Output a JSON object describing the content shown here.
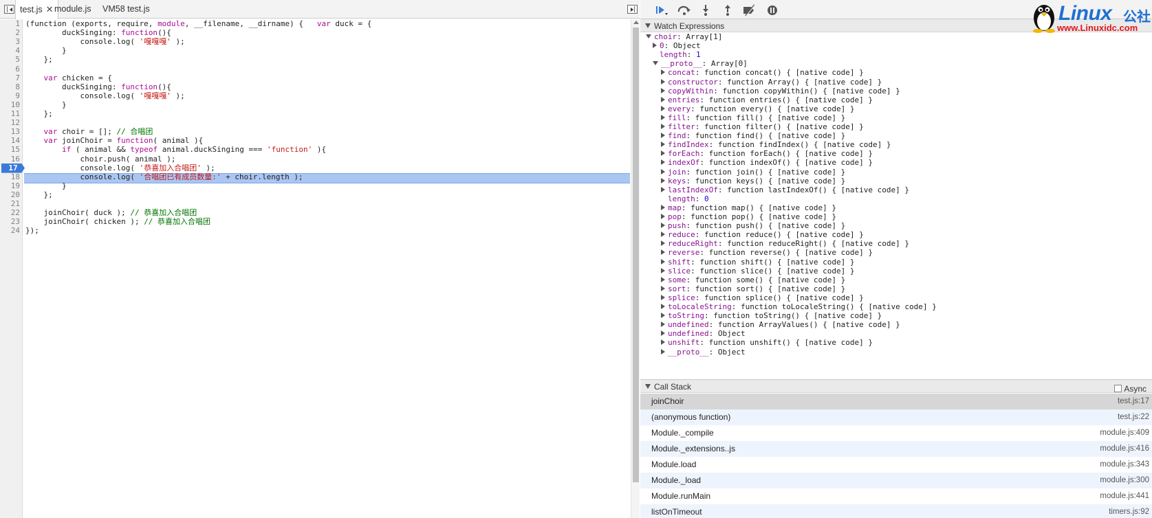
{
  "tabs": [
    {
      "label": "test.js",
      "active": true
    },
    {
      "label": "module.js",
      "active": false
    },
    {
      "label": "VM58 test.js",
      "active": false
    }
  ],
  "editor": {
    "current_line": 17,
    "lines": [
      "1",
      "2",
      "3",
      "4",
      "5",
      "6",
      "7",
      "8",
      "9",
      "10",
      "11",
      "12",
      "13",
      "14",
      "15",
      "16",
      "17",
      "18",
      "19",
      "20",
      "21",
      "22",
      "23",
      "24"
    ],
    "code": {
      "l1a": "(function (exports, require, ",
      "l1b": "module",
      "l1c": ", __filename, __dirname) {   ",
      "l1d": "var",
      "l1e": " duck = {",
      "l2a": "        duckSinging: ",
      "l2b": "function",
      "l2c": "(){",
      "l3a": "            console.log( ",
      "l3b": "'嘎嘎嘎'",
      "l3c": " );",
      "l4": "        }",
      "l5": "    };",
      "l7a": "    ",
      "l7b": "var",
      "l7c": " chicken = {",
      "l8a": "        duckSinging: ",
      "l8b": "function",
      "l8c": "(){",
      "l9a": "            console.log( ",
      "l9b": "'嘎嘎嘎'",
      "l9c": " );",
      "l10": "        }",
      "l11": "    };",
      "l13a": "    ",
      "l13b": "var",
      "l13c": " choir = []; ",
      "l13d": "// 合唱团",
      "l14a": "    ",
      "l14b": "var",
      "l14c": " joinChoir = ",
      "l14d": "function",
      "l14e": "( animal ){",
      "l15a": "        ",
      "l15b": "if",
      "l15c": " ( animal && ",
      "l15d": "typeof",
      "l15e": " animal.duckSinging === ",
      "l15f": "'function'",
      "l15g": " ){",
      "l16": "            choir.push( animal );",
      "l17a": "            console.log( ",
      "l17b": "'恭喜加入合唱团'",
      "l17c": " );",
      "l18a": "            console.log( ",
      "l18b": "'合唱团已有成员数量:'",
      "l18c": " + choir.length );",
      "l19": "        }",
      "l20": "    };",
      "l22a": "    joinChoir( duck ); ",
      "l22b": "// 恭喜加入合唱团",
      "l23a": "    joinChoir( chicken ); ",
      "l23b": "// 恭喜加入合唱团",
      "l24": "});"
    }
  },
  "watch": {
    "title": "Watch Expressions",
    "root_key": "choir",
    "root_val": ": Array[1]",
    "item0_key": "0",
    "item0_val": ": Object",
    "length_key": "length",
    "length_sep": ": ",
    "length_val": "1",
    "proto_key": "__proto__",
    "proto_val": ": Array[0]",
    "proto_items": [
      {
        "key": "concat",
        "val": ": function concat() { [native code] }"
      },
      {
        "key": "constructor",
        "val": ": function Array() { [native code] }"
      },
      {
        "key": "copyWithin",
        "val": ": function copyWithin() { [native code] }"
      },
      {
        "key": "entries",
        "val": ": function entries() { [native code] }"
      },
      {
        "key": "every",
        "val": ": function every() { [native code] }"
      },
      {
        "key": "fill",
        "val": ": function fill() { [native code] }"
      },
      {
        "key": "filter",
        "val": ": function filter() { [native code] }"
      },
      {
        "key": "find",
        "val": ": function find() { [native code] }"
      },
      {
        "key": "findIndex",
        "val": ": function findIndex() { [native code] }"
      },
      {
        "key": "forEach",
        "val": ": function forEach() { [native code] }"
      },
      {
        "key": "indexOf",
        "val": ": function indexOf() { [native code] }"
      },
      {
        "key": "join",
        "val": ": function join() { [native code] }"
      },
      {
        "key": "keys",
        "val": ": function keys() { [native code] }"
      },
      {
        "key": "lastIndexOf",
        "val": ": function lastIndexOf() { [native code] }"
      },
      {
        "key": "length",
        "val": ": ",
        "num": "0",
        "leaf": true
      },
      {
        "key": "map",
        "val": ": function map() { [native code] }"
      },
      {
        "key": "pop",
        "val": ": function pop() { [native code] }"
      },
      {
        "key": "push",
        "val": ": function push() { [native code] }"
      },
      {
        "key": "reduce",
        "val": ": function reduce() { [native code] }"
      },
      {
        "key": "reduceRight",
        "val": ": function reduceRight() { [native code] }"
      },
      {
        "key": "reverse",
        "val": ": function reverse() { [native code] }"
      },
      {
        "key": "shift",
        "val": ": function shift() { [native code] }"
      },
      {
        "key": "slice",
        "val": ": function slice() { [native code] }"
      },
      {
        "key": "some",
        "val": ": function some() { [native code] }"
      },
      {
        "key": "sort",
        "val": ": function sort() { [native code] }"
      },
      {
        "key": "splice",
        "val": ": function splice() { [native code] }"
      },
      {
        "key": "toLocaleString",
        "val": ": function toLocaleString() { [native code] }"
      },
      {
        "key": "toString",
        "val": ": function toString() { [native code] }"
      },
      {
        "key": "undefined",
        "val": ": function ArrayValues() { [native code] }"
      },
      {
        "key": "undefined",
        "val": ": Object"
      },
      {
        "key": "unshift",
        "val": ": function unshift() { [native code] }"
      },
      {
        "key": "__proto__",
        "val": ": Object"
      }
    ]
  },
  "call_stack": {
    "title": "Call Stack",
    "async_label": "Async",
    "frames": [
      {
        "fn": "joinChoir",
        "loc": "test.js:17"
      },
      {
        "fn": "(anonymous function)",
        "loc": "test.js:22"
      },
      {
        "fn": "Module._compile",
        "loc": "module.js:409"
      },
      {
        "fn": "Module._extensions..js",
        "loc": "module.js:416"
      },
      {
        "fn": "Module.load",
        "loc": "module.js:343"
      },
      {
        "fn": "Module._load",
        "loc": "module.js:300"
      },
      {
        "fn": "Module.runMain",
        "loc": "module.js:441"
      },
      {
        "fn": "listOnTimeout",
        "loc": "timers.js:92"
      }
    ]
  },
  "watermark": {
    "brand": "Linux",
    "brand_cn": "公社",
    "url": "www.Linuxidc.com"
  },
  "colors": {
    "accent_blue": "#3a7ad8",
    "exec_highlight": "#aac6f2",
    "keyword": "#aa0d91",
    "string": "#c41a16",
    "comment": "#007400"
  }
}
